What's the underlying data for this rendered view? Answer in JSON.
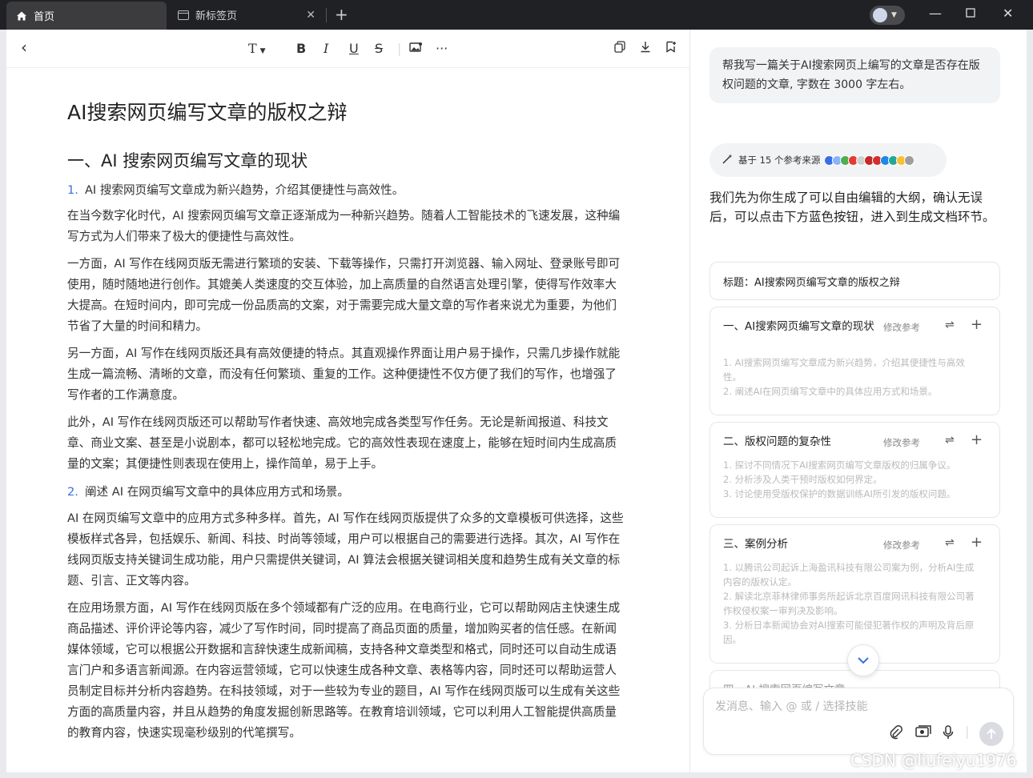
{
  "browser": {
    "tabs": [
      {
        "label": "首页",
        "icon": "home-icon",
        "active": true
      },
      {
        "label": "新标签页",
        "icon": "tab-icon",
        "active": false
      }
    ]
  },
  "toolbar": {
    "text_style": "T",
    "bold": "B",
    "italic": "I",
    "underline": "U",
    "strike": "S",
    "more": "···"
  },
  "document": {
    "title": "AI搜索网页编写文章的版权之辩",
    "section_heading": "一、AI 搜索网页编写文章的现状",
    "blocks": [
      {
        "num": "1.",
        "text": "AI 搜索网页编写文章成为新兴趋势，介绍其便捷性与高效性。"
      },
      {
        "num": "",
        "text": "在当今数字化时代，AI 搜索网页编写文章正逐渐成为一种新兴趋势。随着人工智能技术的飞速发展，这种编写方式为人们带来了极大的便捷性与高效性。"
      },
      {
        "num": "",
        "text": "一方面，AI 写作在线网页版无需进行繁琐的安装、下载等操作，只需打开浏览器、输入网址、登录账号即可使用，随时随地进行创作。其媲美人类速度的交互体验，加上高质量的自然语言处理引擎，使得写作效率大大提高。在短时间内，即可完成一份品质高的文案，对于需要完成大量文章的写作者来说尤为重要，为他们节省了大量的时间和精力。"
      },
      {
        "num": "",
        "text": "另一方面，AI 写作在线网页版还具有高效便捷的特点。其直观操作界面让用户易于操作，只需几步操作就能生成一篇流畅、清晰的文章，而没有任何繁琐、重复的工作。这种便捷性不仅方便了我们的写作，也增强了写作者的工作满意度。"
      },
      {
        "num": "",
        "text": "此外，AI 写作在线网页版还可以帮助写作者快速、高效地完成各类型写作任务。无论是新闻报道、科技文章、商业文案、甚至是小说剧本，都可以轻松地完成。它的高效性表现在速度上，能够在短时间内生成高质量的文案；其便捷性则表现在使用上，操作简单，易于上手。"
      },
      {
        "num": "2.",
        "text": "阐述 AI 在网页编写文章中的具体应用方式和场景。"
      },
      {
        "num": "",
        "text": "AI 在网页编写文章中的应用方式多种多样。首先，AI 写作在线网页版提供了众多的文章模板可供选择，这些模板样式各异，包括娱乐、新闻、科技、时尚等领域，用户可以根据自己的需要进行选择。其次，AI 写作在线网页版支持关键词生成功能，用户只需提供关键词，AI 算法会根据关键词相关度和趋势生成有关文章的标题、引言、正文等内容。"
      },
      {
        "num": "",
        "text": "在应用场景方面，AI 写作在线网页版在多个领域都有广泛的应用。在电商行业，它可以帮助网店主快速生成商品描述、评价评论等内容，减少了写作时间，同时提高了商品页面的质量，增加购买者的信任感。在新闻媒体领域，它可以根据公开数据和言辞快速生成新闻稿，支持各种文章类型和格式，同时还可以自动生成语言门户和多语言新闻源。在内容运营领域，它可以快速生成各种文章、表格等内容，同时还可以帮助运营人员制定目标并分析内容趋势。在科技领域，对于一些较为专业的题目，AI 写作在线网页版可以生成有关这些方面的高质量内容，并且从趋势的角度发掘创新思路等。在教育培训领域，它可以利用人工智能提供高质量的教育内容，快速实现毫秒级别的代笔撰写。"
      }
    ]
  },
  "chat": {
    "user_message": "帮我写一篇关于AI搜索网页上编写的文章是否存在版权问题的文章, 字数在 3000 字左右。",
    "sources_label": "基于 15 个参考来源",
    "reply": "我们先为你生成了可以自由编辑的大纲，确认无误后，可以点击下方蓝色按钮，进入到生成文档环节。",
    "outline_title": "标题：AI搜索网页编写文章的版权之辩",
    "edit_ref_label": "修改参考",
    "sections": [
      {
        "heading": "一、AI搜索网页编写文章的现状",
        "items": [
          "1. AI搜索网页编写文章成为新兴趋势，介绍其便捷性与高效性。",
          "2. 阐述AI在网页编写文章中的具体应用方式和场景。"
        ]
      },
      {
        "heading": "二、版权问题的复杂性",
        "items": [
          "1. 探讨不同情况下AI搜索网页编写文章版权的归属争议。",
          "2. 分析涉及人类干预时版权如何界定。",
          "3. 讨论使用受版权保护的数据训练AI所引发的版权问题。"
        ]
      },
      {
        "heading": "三、案例分析",
        "items": [
          "1. 以腾讯公司起诉上海盈讯科技有限公司案为例，分析AI生成内容的版权认定。",
          "2. 解读北京菲林律师事务所起诉北京百度网讯科技有限公司著作权侵权案一审判决及影响。",
          "3. 分析日本新闻协会对AI搜索可能侵犯著作权的声明及背后原因。"
        ]
      },
      {
        "heading": "四、AI 搜索网页编写文章",
        "items": []
      }
    ],
    "input_placeholder": "发消息、输入 @ 或 / 选择技能"
  },
  "watermark": "CSDN @liufeiyu1976",
  "colors": {
    "accent": "#3b6fe0",
    "titlebar": "#202124"
  }
}
